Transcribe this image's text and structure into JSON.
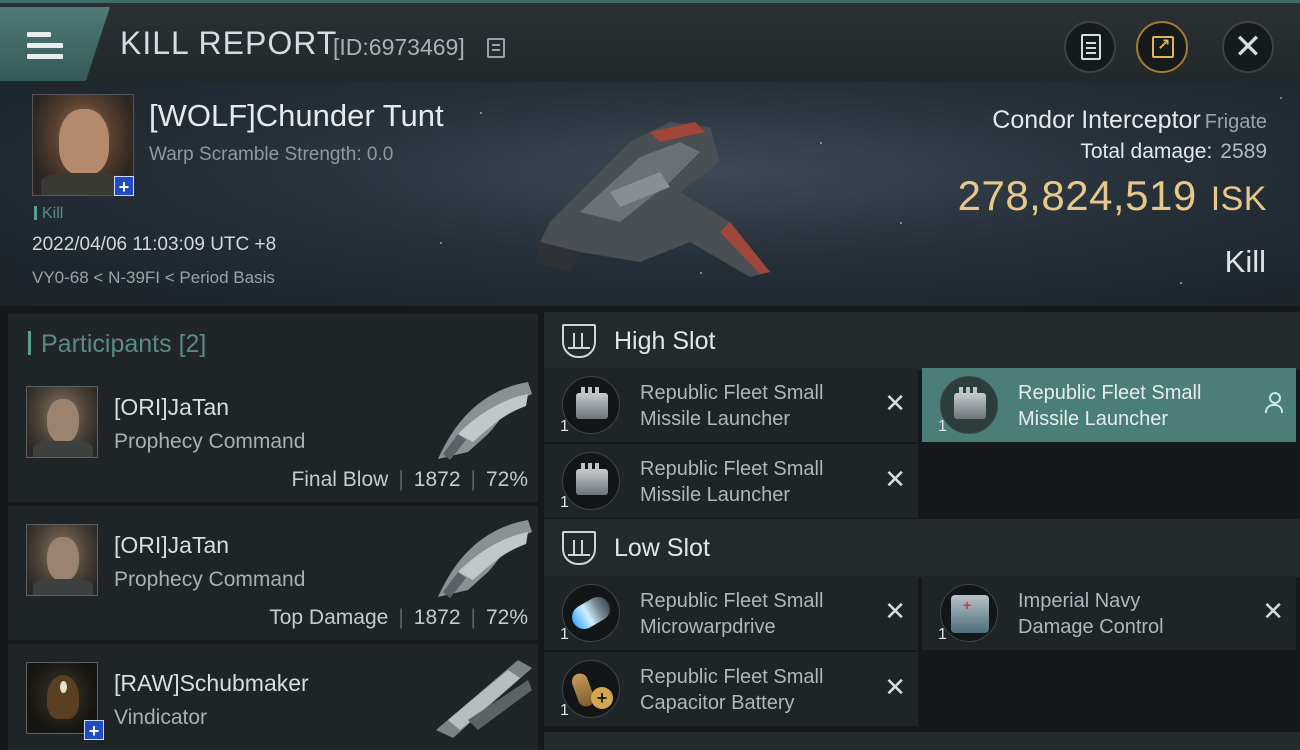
{
  "header": {
    "title": "KILL REPORT",
    "report_id": "[ID:6973469]"
  },
  "victim": {
    "pilot": "[WOLF]Chunder Tunt",
    "warp_scramble": "Warp Scramble Strength: 0.0",
    "tag": "Kill",
    "datetime": "2022/04/06 11:03:09 UTC +8",
    "location": "VY0-68 < N-39FI < Period Basis",
    "ship": "Condor Interceptor",
    "ship_class": "Frigate",
    "total_damage_label": "Total damage:",
    "total_damage": "2589",
    "isk_value": "278,824,519",
    "isk_unit": "ISK",
    "result": "Kill"
  },
  "participants": {
    "label": "Participants",
    "count": "[2]",
    "items": [
      {
        "name": "[ORI]JaTan",
        "ship": "Prophecy Command",
        "role": "Final Blow",
        "damage": "1872",
        "percent": "72%"
      },
      {
        "name": "[ORI]JaTan",
        "ship": "Prophecy Command",
        "role": "Top Damage",
        "damage": "1872",
        "percent": "72%"
      },
      {
        "name": "[RAW]Schubmaker",
        "ship": "Vindicator"
      }
    ]
  },
  "fitting": {
    "high_slot": {
      "label": "High Slot",
      "modules": [
        {
          "name_line1": "Republic Fleet Small",
          "name_line2": "Missile Launcher",
          "qty": "1",
          "icon": "missile-launcher-icon",
          "active": false
        },
        {
          "name_line1": "Republic Fleet Small",
          "name_line2": "Missile Launcher",
          "qty": "1",
          "icon": "missile-launcher-icon",
          "active": true
        },
        {
          "name_line1": "Republic Fleet Small",
          "name_line2": "Missile Launcher",
          "qty": "1",
          "icon": "missile-launcher-icon",
          "active": false
        }
      ]
    },
    "low_slot": {
      "label": "Low Slot",
      "modules": [
        {
          "name_line1": "Republic Fleet Small",
          "name_line2": "Microwarpdrive",
          "qty": "1",
          "icon": "microwarpdrive-icon"
        },
        {
          "name_line1": "Imperial Navy",
          "name_line2": "Damage Control",
          "qty": "1",
          "icon": "damage-control-icon"
        },
        {
          "name_line1": "Republic Fleet Small",
          "name_line2": "Capacitor Battery",
          "qty": "1",
          "icon": "capacitor-battery-icon"
        }
      ]
    }
  },
  "colors": {
    "accent": "#5aa091",
    "isk": "#e9c78a",
    "active_module": "#4b7e78"
  }
}
